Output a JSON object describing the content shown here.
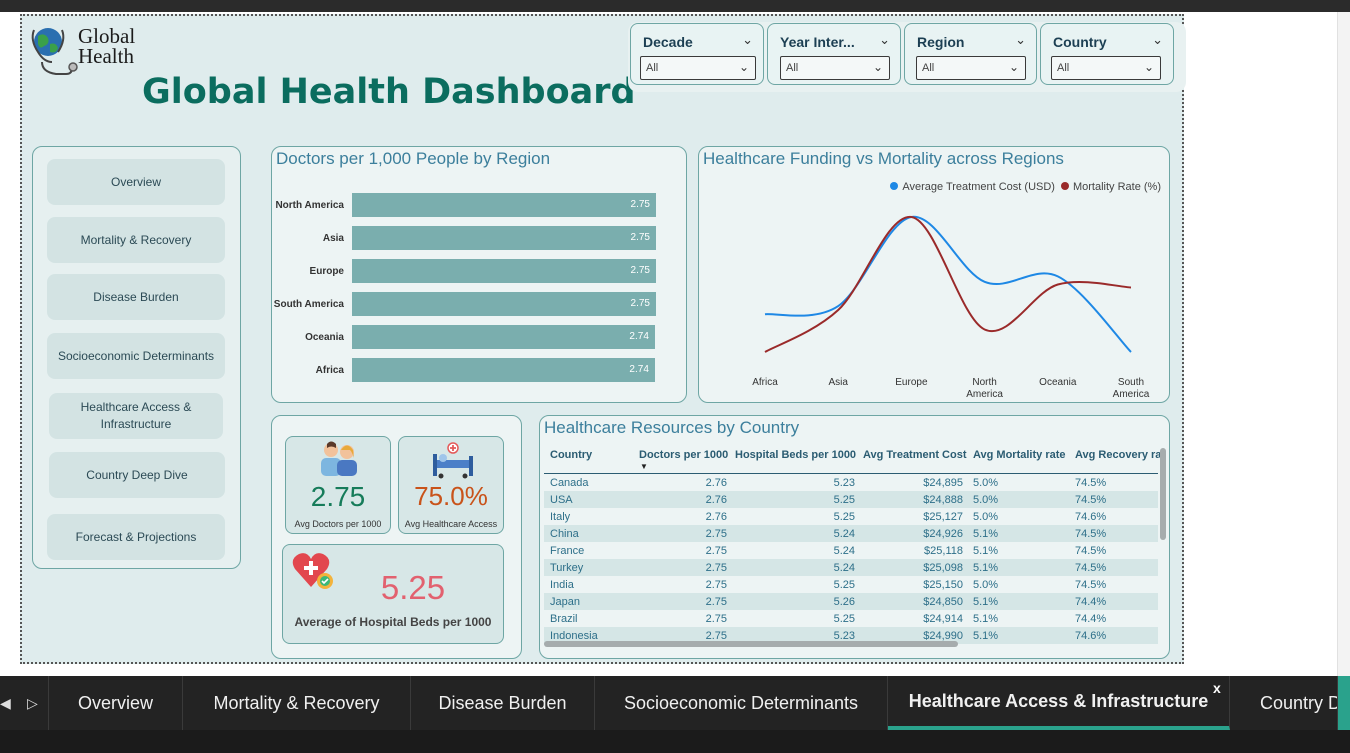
{
  "logo": {
    "line1": "Global",
    "line2": "Health"
  },
  "title": "Global Health Dashboard",
  "slicers": [
    {
      "label": "Decade",
      "value": "All"
    },
    {
      "label": "Year Inter...",
      "value": "All"
    },
    {
      "label": "Region",
      "value": "All"
    },
    {
      "label": "Country",
      "value": "All"
    }
  ],
  "nav": [
    "Overview",
    "Mortality & Recovery",
    "Disease Burden",
    "Socioeconomic Determinants",
    "Healthcare Access & Infrastructure",
    "Country Deep Dive",
    "Forecast & Projections"
  ],
  "doctors_chart": {
    "title": "Doctors per 1,000 People by Region",
    "chart_data": {
      "type": "bar",
      "orientation": "horizontal",
      "categories": [
        "North America",
        "Asia",
        "Europe",
        "South America",
        "Oceania",
        "Africa"
      ],
      "values": [
        2.75,
        2.75,
        2.75,
        2.75,
        2.74,
        2.74
      ],
      "labels": [
        "2.75",
        "2.75",
        "2.75",
        "2.75",
        "2.74",
        "2.74"
      ]
    }
  },
  "funding_chart": {
    "title": "Healthcare Funding vs Mortality across Regions",
    "chart_data": {
      "type": "line",
      "categories": [
        "Africa",
        "Asia",
        "Europe",
        "North America",
        "Oceania",
        "South America"
      ],
      "category_lines": [
        [
          "Africa"
        ],
        [
          "Asia"
        ],
        [
          "Europe"
        ],
        [
          "North",
          "America"
        ],
        [
          "Oceania"
        ],
        [
          "South",
          "America"
        ]
      ],
      "series": [
        {
          "name": "Average Treatment Cost (USD)",
          "color": "#1e88e5",
          "values": [
            24960,
            24975,
            25140,
            25020,
            25030,
            24890
          ]
        },
        {
          "name": "Mortality Rate (%)",
          "color": "#9a2a2a",
          "values": [
            5.02,
            5.048,
            5.11,
            5.035,
            5.065,
            5.063
          ]
        }
      ],
      "legend_position": "top-right",
      "grid": false
    }
  },
  "kpis": {
    "doctors": {
      "value": "2.75",
      "label": "Avg Doctors per 1000"
    },
    "access": {
      "value": "75.0%",
      "label": "Avg Healthcare Access"
    },
    "beds": {
      "value": "5.25",
      "label": "Average of Hospital Beds per 1000"
    }
  },
  "resources": {
    "title": "Healthcare Resources by Country",
    "columns": [
      "Country",
      "Doctors per 1000",
      "Hospital Beds per 1000",
      "Avg Treatment Cost",
      "Avg Mortality rate",
      "Avg Recovery rat"
    ],
    "rows": [
      [
        "Canada",
        "2.76",
        "5.23",
        "$24,895",
        "5.0%",
        "74.5%"
      ],
      [
        "USA",
        "2.76",
        "5.25",
        "$24,888",
        "5.0%",
        "74.5%"
      ],
      [
        "Italy",
        "2.76",
        "5.25",
        "$25,127",
        "5.0%",
        "74.6%"
      ],
      [
        "China",
        "2.75",
        "5.24",
        "$24,926",
        "5.1%",
        "74.5%"
      ],
      [
        "France",
        "2.75",
        "5.24",
        "$25,118",
        "5.1%",
        "74.5%"
      ],
      [
        "Turkey",
        "2.75",
        "5.24",
        "$25,098",
        "5.1%",
        "74.5%"
      ],
      [
        "India",
        "2.75",
        "5.25",
        "$25,150",
        "5.0%",
        "74.5%"
      ],
      [
        "Japan",
        "2.75",
        "5.26",
        "$24,850",
        "5.1%",
        "74.4%"
      ],
      [
        "Brazil",
        "2.75",
        "5.25",
        "$24,914",
        "5.1%",
        "74.4%"
      ],
      [
        "Indonesia",
        "2.75",
        "5.23",
        "$24,990",
        "5.1%",
        "74.6%"
      ]
    ]
  },
  "tabs": [
    {
      "label": "Overview",
      "active": false
    },
    {
      "label": "Mortality & Recovery",
      "active": false
    },
    {
      "label": "Disease Burden",
      "active": false
    },
    {
      "label": "Socioeconomic Determinants",
      "active": false
    },
    {
      "label": "Healthcare Access & Infrastructure",
      "active": true
    },
    {
      "label": "Country D",
      "active": false
    }
  ],
  "tab_close": "x",
  "icons": {
    "tab_prev": "tab-prev-icon",
    "tab_next": "tab-next-icon"
  }
}
